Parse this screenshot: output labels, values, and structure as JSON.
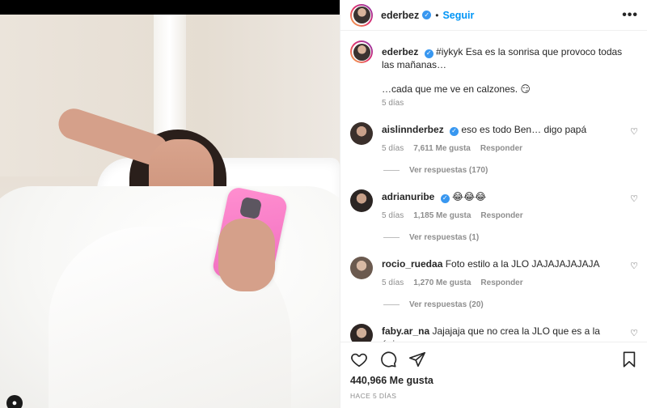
{
  "post": {
    "username": "ederbez",
    "follow_label": "Seguir",
    "more_icon": "more-horizontal-icon"
  },
  "caption": {
    "username": "ederbez",
    "text_line1": "#iykyk Esa es la sonrisa que provoco todas las mañanas…",
    "text_line2": "…cada que me ve en calzones. 😏",
    "time": "5 días"
  },
  "comments": [
    {
      "username": "aislinnderbez",
      "verified": true,
      "text": "eso es todo Ben… digo papá",
      "time": "5 días",
      "likes": "7,611 Me gusta",
      "reply_label": "Responder",
      "view_replies": "Ver respuestas (170)"
    },
    {
      "username": "adrianuribe",
      "verified": true,
      "text": "😂😂😂",
      "time": "5 días",
      "likes": "1,185 Me gusta",
      "reply_label": "Responder",
      "view_replies": "Ver respuestas (1)"
    },
    {
      "username": "rocio_ruedaa",
      "verified": false,
      "text": "Foto estilo a la JLO JAJAJAJAJAJA",
      "time": "5 días",
      "likes": "1,270 Me gusta",
      "reply_label": "Responder",
      "view_replies": "Ver respuestas (20)"
    },
    {
      "username": "faby.ar_na",
      "verified": false,
      "text": "Jajajaja que no crea la JLO que es a la única que",
      "time": "",
      "likes": "",
      "reply_label": "",
      "view_replies": ""
    }
  ],
  "actions": {
    "likes": "440,966 Me gusta",
    "posted": "HACE 5 DÍAS"
  },
  "colors": {
    "accent": "#0095f6",
    "verified": "#3897f0",
    "muted": "#8e8e8e",
    "phone_case": "#f06bbf"
  }
}
